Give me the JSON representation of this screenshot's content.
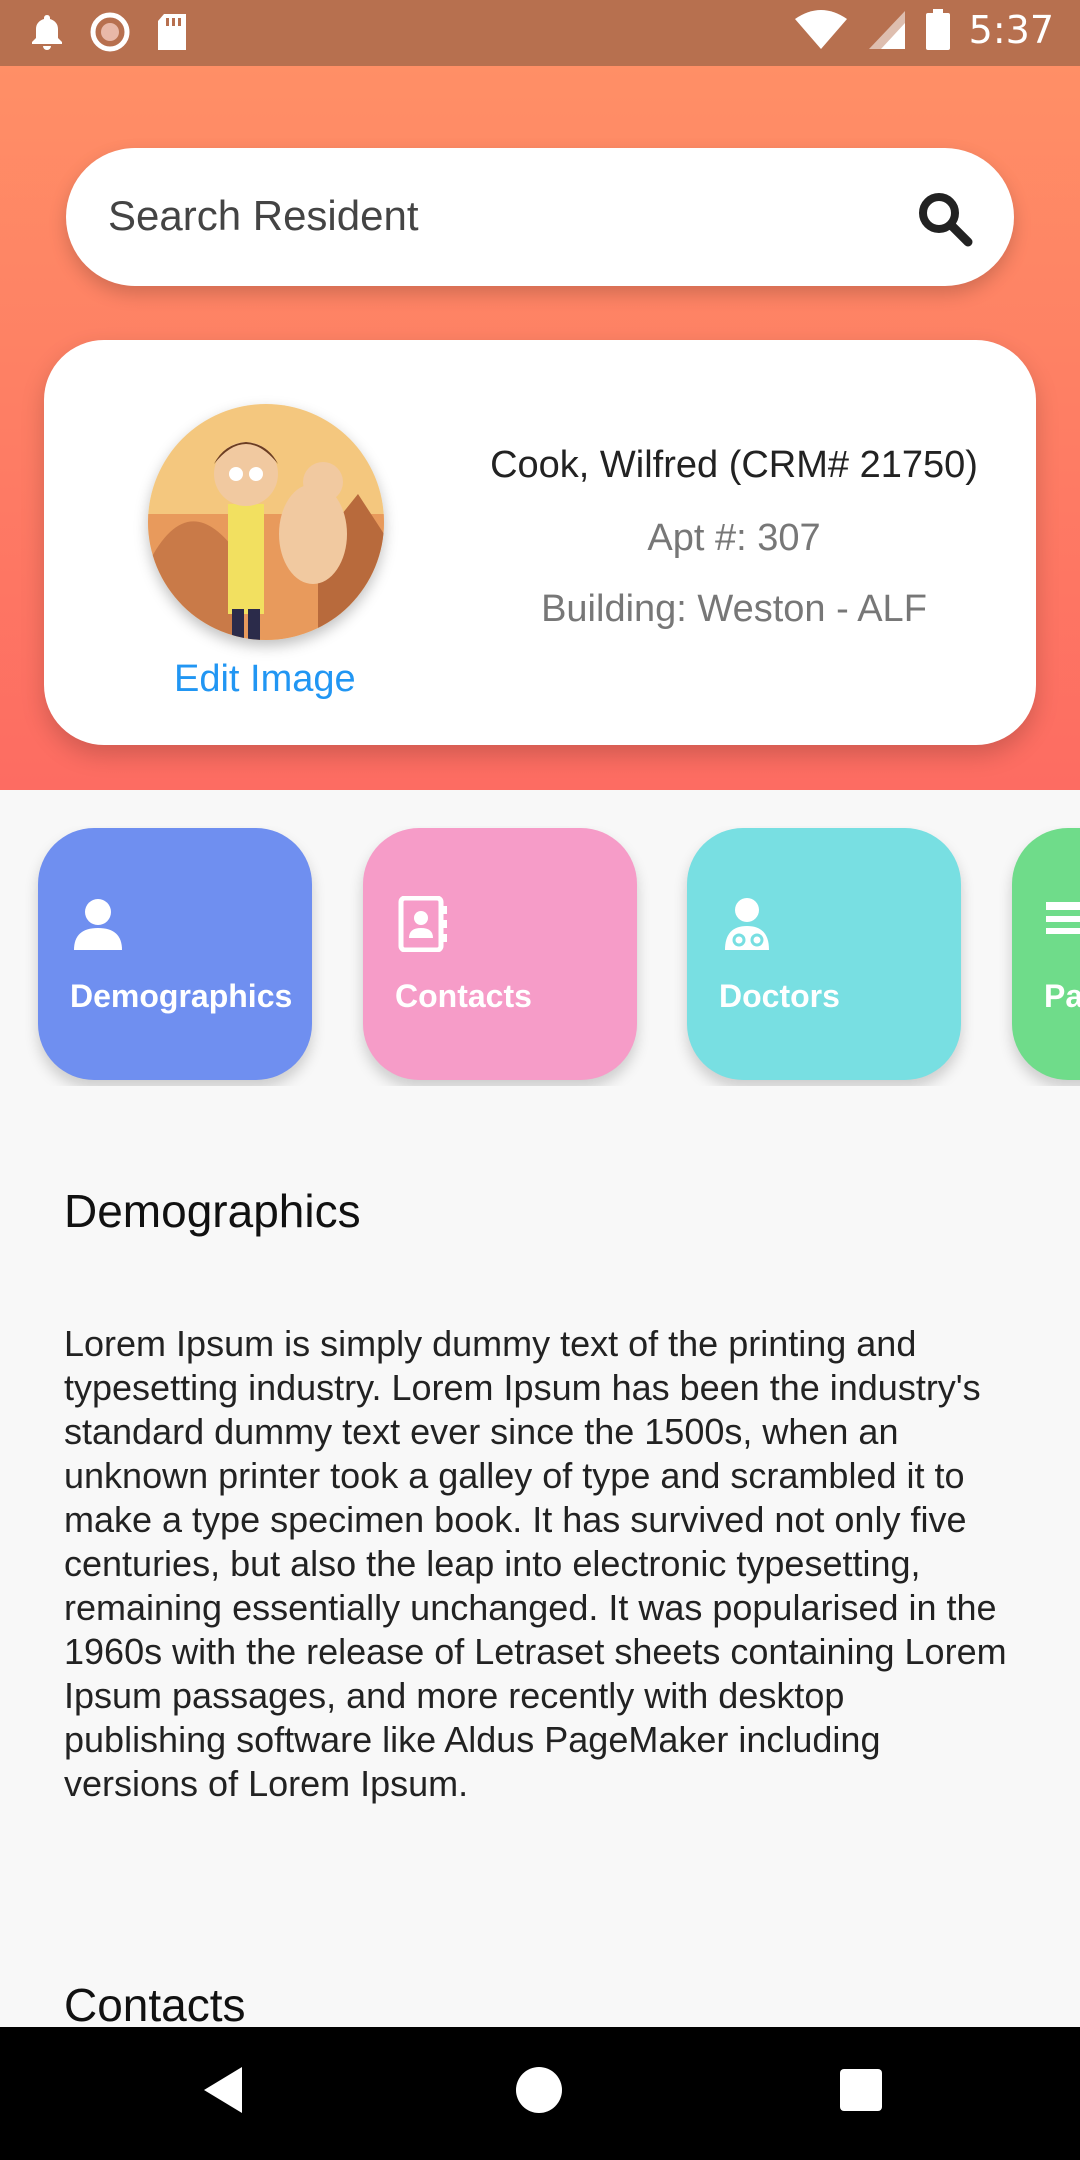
{
  "status_bar": {
    "time": "5:37",
    "left_icons": [
      "notification-bell-icon",
      "record-icon",
      "sd-card-icon"
    ],
    "right_icons": [
      "wifi-icon",
      "signal-icon",
      "battery-icon"
    ]
  },
  "search": {
    "placeholder": "Search Resident",
    "icon": "search-icon"
  },
  "resident": {
    "name": "Cook, Wilfred (CRM# 21750)",
    "apt": "Apt #: 307",
    "building": "Building: Weston - ALF",
    "edit_image_label": "Edit Image"
  },
  "tiles": [
    {
      "label": "Demographics",
      "icon": "person-icon",
      "color": "#6f8ff0"
    },
    {
      "label": "Contacts",
      "icon": "contacts-book-icon",
      "color": "#f69cc8"
    },
    {
      "label": "Doctors",
      "icon": "doctor-icon",
      "color": "#78dfe2"
    },
    {
      "label": "Pa",
      "icon": "notes-icon",
      "color": "#6fdc8a"
    }
  ],
  "sections": {
    "demographics_title": "Demographics",
    "demographics_body": "Lorem Ipsum is simply dummy text of the printing and typesetting industry. Lorem Ipsum has been the industry's standard dummy text ever since the 1500s, when an unknown printer took a galley of type and scrambled it to make a type specimen book. It has survived not only five centuries, but also the leap into electronic typesetting, remaining essentially unchanged. It was popularised in the 1960s with the release of Letraset sheets containing Lorem Ipsum passages, and more recently with desktop publishing software like Aldus PageMaker including versions of Lorem Ipsum.",
    "contacts_title": "Contacts"
  },
  "colors": {
    "header_top": "#ff8f66",
    "header_bottom": "#fd6c62",
    "status_bar": "#b7704f",
    "link": "#2196f3"
  },
  "navigation": {
    "buttons": [
      "back-icon",
      "home-icon",
      "recents-icon"
    ]
  }
}
